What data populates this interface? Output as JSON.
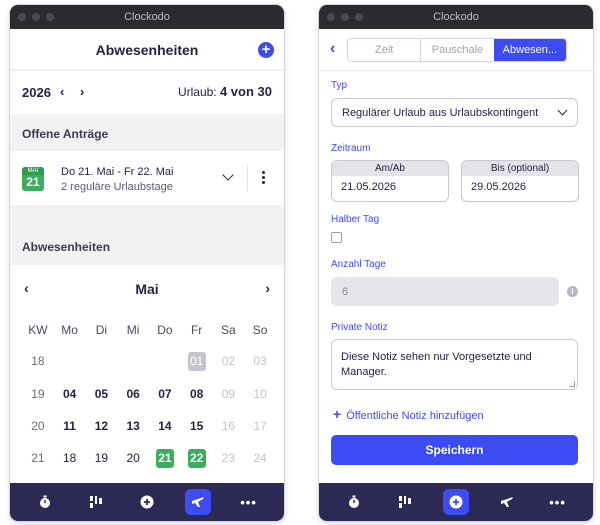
{
  "app_title": "Clockodo",
  "left": {
    "header_title": "Abwesenheiten",
    "year": "2026",
    "vacation_label": "Urlaub:",
    "vacation_value": "4 von 30",
    "open_requests_title": "Offene Anträge",
    "request": {
      "badge_month": "MAI",
      "badge_day": "21",
      "dates": "Do 21. Mai - Fr 22. Mai",
      "detail": "2 reguläre Urlaubstage"
    },
    "absences_title": "Abwesenheiten",
    "calendar": {
      "month": "Mai",
      "weekdays": [
        "KW",
        "Mo",
        "Di",
        "Mi",
        "Do",
        "Fr",
        "Sa",
        "So"
      ],
      "rows": [
        [
          "18",
          "",
          "",
          "",
          "",
          "01",
          "02",
          "03"
        ],
        [
          "19",
          "04",
          "05",
          "06",
          "07",
          "08",
          "09",
          "10"
        ],
        [
          "20",
          "11",
          "12",
          "13",
          "14",
          "15",
          "16",
          "17"
        ],
        [
          "21",
          "18",
          "19",
          "20",
          "21",
          "22",
          "23",
          "24"
        ]
      ]
    }
  },
  "right": {
    "segments": [
      "Zeit",
      "Pauschale",
      "Abwesen..."
    ],
    "type_label": "Typ",
    "type_value": "Regulärer Urlaub aus Urlaubskontingent",
    "period_label": "Zeitraum",
    "from_label": "Am/Ab",
    "from_value": "21.05.2026",
    "to_label": "Bis (optional)",
    "to_value": "29.05.2026",
    "half_day_label": "Halber Tag",
    "days_label": "Anzahl Tage",
    "days_value": "6",
    "private_note_label": "Private Notiz",
    "private_note_value": "Diese Notiz sehen nur Vorgesetzte und Manager.",
    "public_note_link": "Öffentliche Notiz hinzufügen",
    "save_label": "Speichern"
  },
  "colors": {
    "accent": "#3d4bf2",
    "tabbar": "#2c2a55",
    "green": "#3aae5c",
    "titlebar": "#2b2a2e"
  }
}
